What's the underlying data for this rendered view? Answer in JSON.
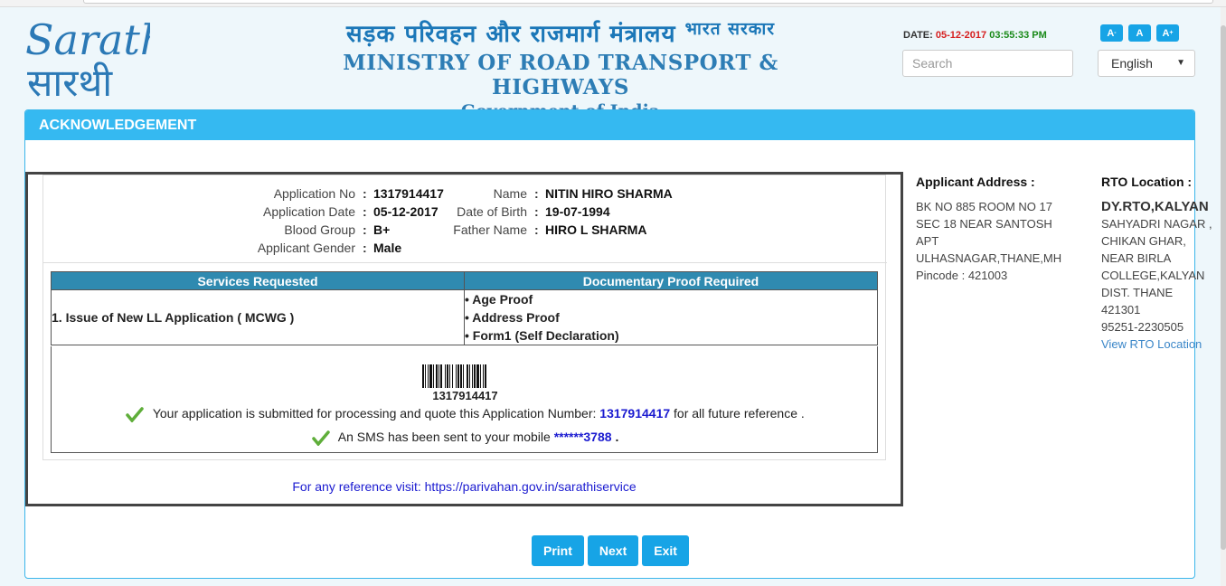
{
  "header": {
    "logo_text_en": "Sarathi",
    "logo_text_hi": "सारथी",
    "ministry_hindi": "सड़क परिवहन और राजमार्ग मंत्रालय",
    "govt_hindi": "भारत सरकार",
    "ministry_en": "MINISTRY OF ROAD TRANSPORT & HIGHWAYS",
    "govt_en": "Government of India",
    "date_label": "DATE:",
    "date_value": "05-12-2017",
    "time_value": "03:55:33 PM",
    "font_small": "A",
    "font_normal": "A",
    "font_large": "A",
    "search_placeholder": "Search",
    "language": "English"
  },
  "panel": {
    "title": "ACKNOWLEDGEMENT"
  },
  "applicant": {
    "app_no_label": "Application No",
    "app_no": "1317914417",
    "app_date_label": "Application Date",
    "app_date": "05-12-2017",
    "blood_label": "Blood Group",
    "blood": "B+",
    "gender_label": "Applicant Gender",
    "gender": "Male",
    "name_label": "Name",
    "name": "NITIN HIRO SHARMA",
    "dob_label": "Date of Birth",
    "dob": "19-07-1994",
    "father_label": "Father Name",
    "father": "HIRO L SHARMA",
    "colon": ":"
  },
  "services": {
    "col1": "Services Requested",
    "col2": "Documentary Proof Required",
    "service": "1. Issue of New LL Application ( MCWG )",
    "proofs": [
      "• Age Proof",
      "• Address Proof",
      "• Form1 (Self Declaration)"
    ]
  },
  "confirmation": {
    "barcode_number": "1317914417",
    "msg1_prefix": "Your application is submitted for processing and quote this Application Number:",
    "msg1_number": "1317914417",
    "msg1_suffix": "for all future reference .",
    "msg2_prefix": "An SMS has been sent to your mobile",
    "msg2_mobile": "******3788",
    "msg2_suffix": "."
  },
  "reference": "For any reference visit: https://parivahan.gov.in/sarathiservice",
  "address": {
    "heading": "Applicant Address :",
    "lines": [
      "BK NO 885 ROOM NO 17",
      "SEC 18 NEAR SANTOSH",
      "APT",
      "ULHASNAGAR,THANE,MH",
      "Pincode : 421003"
    ]
  },
  "rto": {
    "heading": "RTO Location :",
    "office": "DY.RTO,KALYAN",
    "lines": [
      "SAHYADRI NAGAR ,",
      "CHIKAN GHAR,",
      "NEAR BIRLA",
      "COLLEGE,KALYAN",
      "DIST. THANE",
      "421301",
      "95251-2230505"
    ],
    "link": "View RTO Location"
  },
  "buttons": {
    "print": "Print",
    "next": "Next",
    "exit": "Exit"
  },
  "colors": {
    "accent": "#35b9f1",
    "table_header": "#2f8ab0",
    "button": "#17a4e6"
  }
}
